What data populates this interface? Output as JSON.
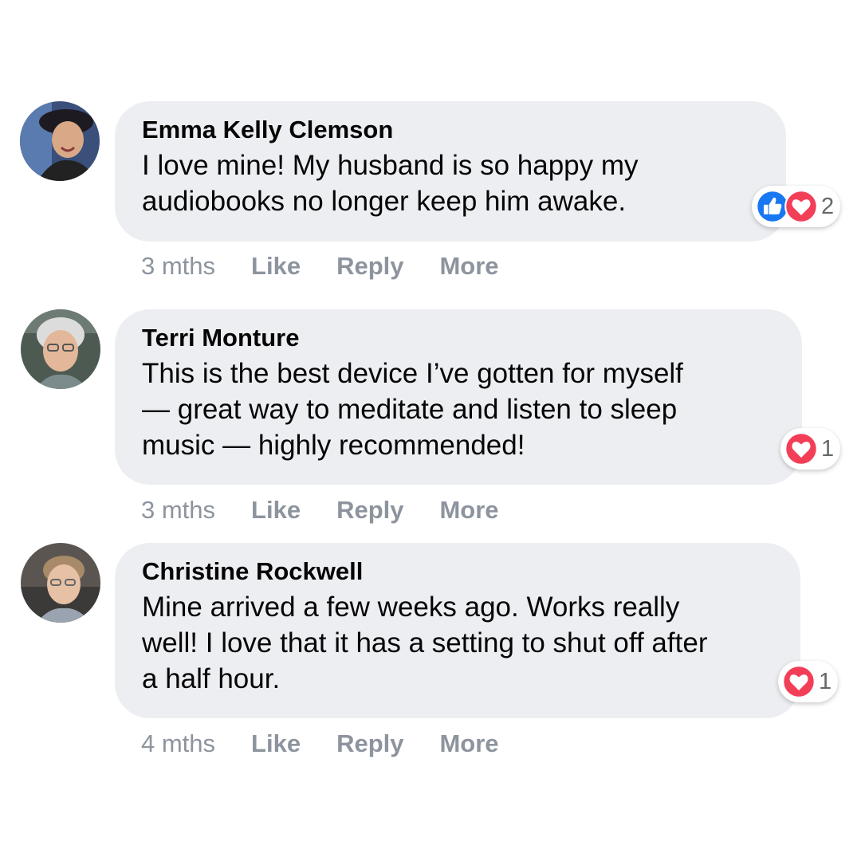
{
  "comments": [
    {
      "author": "Emma Kelly Clemson",
      "lines": [
        "I love mine! My husband is so happy my",
        "audiobooks no longer keep him awake."
      ],
      "time": "3 mths",
      "actions": {
        "like": "Like",
        "reply": "Reply",
        "more": "More"
      },
      "reactions": {
        "icons": [
          "like-icon",
          "love-icon"
        ],
        "count": "2"
      },
      "avatar_colors": {
        "bg": "#3a4f7a",
        "face": "#d9a887",
        "hair": "#1e1a22"
      }
    },
    {
      "author": "Terri Monture",
      "lines": [
        "This is the best device I’ve gotten for myself",
        "— great way to meditate and listen to sleep",
        "music — highly recommended!"
      ],
      "time": "3 mths",
      "actions": {
        "like": "Like",
        "reply": "Reply",
        "more": "More"
      },
      "reactions": {
        "icons": [
          "love-icon"
        ],
        "count": "1"
      },
      "avatar_colors": {
        "bg": "#4c5a52",
        "face": "#e3b89a",
        "hair": "#dcdcdc"
      }
    },
    {
      "author": "Christine Rockwell",
      "lines": [
        "Mine arrived a few weeks ago. Works really",
        "well! I love that it has a setting to shut off after",
        "a half hour."
      ],
      "time": "4 mths",
      "actions": {
        "like": "Like",
        "reply": "Reply",
        "more": "More"
      },
      "reactions": {
        "icons": [
          "love-icon"
        ],
        "count": "1"
      },
      "avatar_colors": {
        "bg": "#5a5550",
        "face": "#e7c1a5",
        "hair": "#a88a68"
      }
    }
  ],
  "colors": {
    "bubble": "#edeef2",
    "action_text": "#8d949e",
    "like_blue": "#1877f2",
    "love_red": "#f33e58"
  }
}
